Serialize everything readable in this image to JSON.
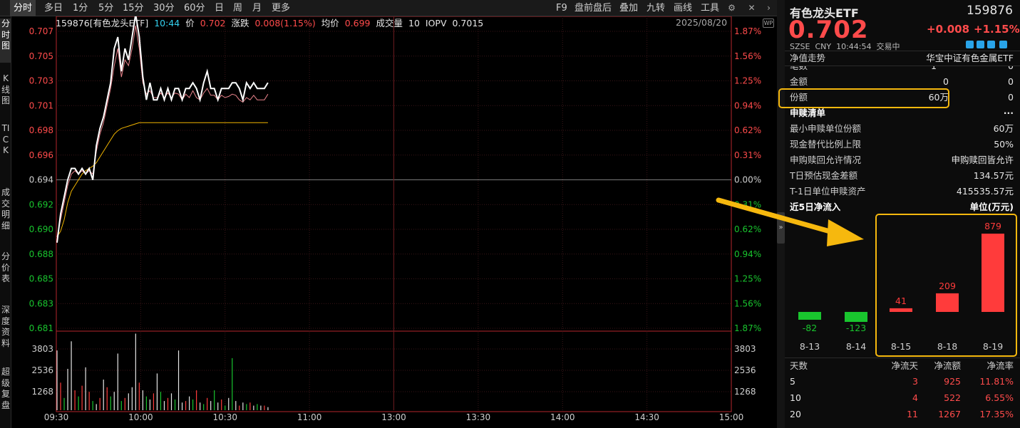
{
  "tabs": [
    "分时",
    "多日",
    "1分",
    "5分",
    "15分",
    "30分",
    "60分",
    "日",
    "周",
    "月",
    "更多"
  ],
  "toolbar": [
    "F9",
    "盘前盘后",
    "叠加",
    "九转",
    "画线",
    "工具"
  ],
  "sidebar": [
    "分时图",
    "K线图",
    "TICK",
    "成交明细",
    "分价表",
    "深度资料",
    "超级复盘"
  ],
  "info": {
    "code_name": "159876[有色龙头ETF]",
    "time": "10:44",
    "price_label": "价",
    "price": "0.702",
    "change_label": "涨跌",
    "change": "0.008(1.15%)",
    "avg_label": "均价",
    "avg": "0.699",
    "vol_label": "成交量",
    "vol": "10",
    "iopv_label": "IOPV",
    "iopv": "0.7015",
    "date": "2025/08/20"
  },
  "chart_data": {
    "type": "line",
    "y_left_ticks": [
      "0.707",
      "0.705",
      "0.703",
      "0.701",
      "0.698",
      "0.696",
      "0.694",
      "0.692",
      "0.690",
      "0.688",
      "0.685",
      "0.683",
      "0.681"
    ],
    "y_right_ticks": [
      "1.87%",
      "1.56%",
      "1.25%",
      "0.94%",
      "0.62%",
      "0.31%",
      "0.00%",
      "0.31%",
      "0.62%",
      "0.94%",
      "1.25%",
      "1.56%",
      "1.87%"
    ],
    "x_ticks": [
      "09:30",
      "10:00",
      "10:30",
      "11:00",
      "13:00",
      "13:30",
      "14:00",
      "14:30",
      "15:00"
    ],
    "vol_ticks": [
      "3803",
      "2536",
      "1268"
    ],
    "y_range": [
      0.681,
      0.707
    ],
    "prev_close": 0.694,
    "price_series": [
      0.6885,
      0.691,
      0.6925,
      0.694,
      0.695,
      0.695,
      0.6945,
      0.695,
      0.6945,
      0.695,
      0.694,
      0.697,
      0.6985,
      0.6995,
      0.701,
      0.7025,
      0.7055,
      0.7065,
      0.7035,
      0.7055,
      0.7045,
      0.7065,
      0.7085,
      0.7065,
      0.703,
      0.701,
      0.7025,
      0.701,
      0.701,
      0.702,
      0.701,
      0.702,
      0.701,
      0.702,
      0.702,
      0.701,
      0.702,
      0.702,
      0.7025,
      0.702,
      0.701,
      0.7025,
      0.7035,
      0.702,
      0.702,
      0.701,
      0.702,
      0.702,
      0.702,
      0.7025,
      0.7025,
      0.702,
      0.701,
      0.7025,
      0.702,
      0.7025,
      0.702,
      0.702,
      0.702,
      0.7025
    ],
    "avg_series": [
      0.689,
      0.6895,
      0.6905,
      0.692,
      0.693,
      0.6935,
      0.694,
      0.6945,
      0.6948,
      0.695,
      0.6952,
      0.6955,
      0.696,
      0.6965,
      0.697,
      0.6975,
      0.698,
      0.6983,
      0.6985,
      0.6986,
      0.6987,
      0.6988,
      0.6989,
      0.699,
      0.699,
      0.699,
      0.699,
      0.699,
      0.699,
      0.699,
      0.699,
      0.699,
      0.699,
      0.699,
      0.699,
      0.699,
      0.699,
      0.699,
      0.699,
      0.699,
      0.699,
      0.699,
      0.699,
      0.699,
      0.699,
      0.699,
      0.699,
      0.699,
      0.699,
      0.699,
      0.699,
      0.699,
      0.699,
      0.699,
      0.699,
      0.699,
      0.699,
      0.699,
      0.699,
      0.699
    ],
    "iopv_series": [
      0.689,
      0.6905,
      0.692,
      0.6935,
      0.6945,
      0.6948,
      0.6945,
      0.6948,
      0.6945,
      0.6948,
      0.6945,
      0.6965,
      0.698,
      0.699,
      0.7005,
      0.702,
      0.704,
      0.7055,
      0.703,
      0.7045,
      0.704,
      0.7055,
      0.7075,
      0.7055,
      0.7025,
      0.7015,
      0.7018,
      0.7012,
      0.7012,
      0.7016,
      0.7012,
      0.7016,
      0.7012,
      0.7016,
      0.7015,
      0.701,
      0.7015,
      0.7012,
      0.7018,
      0.7012,
      0.701,
      0.7016,
      0.702,
      0.7014,
      0.7014,
      0.701,
      0.7014,
      0.7012,
      0.7013,
      0.7015,
      0.7014,
      0.701,
      0.7008,
      0.7012,
      0.701,
      0.7014,
      0.701,
      0.701,
      0.701,
      0.7015
    ],
    "volume_max": 5070,
    "volume": [
      3900,
      1800,
      800,
      2700,
      4500,
      1300,
      900,
      1600,
      2800,
      1200,
      600,
      400,
      800,
      2000,
      1500,
      900,
      1200,
      3700,
      600,
      800,
      1100,
      1500,
      5000,
      1800,
      1300,
      900,
      700,
      1100,
      2400,
      1200,
      600,
      800,
      1100,
      700,
      3900,
      500,
      600,
      900,
      700,
      1300,
      500,
      400,
      800,
      600,
      1300,
      500,
      700,
      300,
      800,
      3400,
      600,
      300,
      500,
      400,
      500,
      300,
      400,
      300,
      300,
      200
    ],
    "volume_color": [
      "w",
      "r",
      "g",
      "w",
      "w",
      "r",
      "g",
      "r",
      "w",
      "r",
      "g",
      "w",
      "r",
      "w",
      "r",
      "g",
      "w",
      "w",
      "g",
      "r",
      "w",
      "w",
      "w",
      "r",
      "w",
      "g",
      "w",
      "r",
      "w",
      "g",
      "w",
      "r",
      "w",
      "g",
      "w",
      "w",
      "r",
      "w",
      "g",
      "r",
      "w",
      "g",
      "r",
      "w",
      "g",
      "w",
      "r",
      "g",
      "w",
      "g",
      "w",
      "r",
      "w",
      "g",
      "r",
      "w",
      "g",
      "w",
      "r",
      "w"
    ]
  },
  "right": {
    "name": "有色龙头ETF",
    "code": "159876",
    "price": "0.702",
    "change": "+0.008",
    "change_pct": "+1.15%",
    "exchange": "SZSE",
    "currency": "CNY",
    "time": "10:44:54",
    "status": "交易中",
    "nav_label": "净值走势",
    "index_name": "华宝中证有色金属ETF",
    "partial_row": {
      "label": "笔数",
      "v1": "1",
      "v2": "0"
    },
    "rows": [
      {
        "label": "金额",
        "v1": "0",
        "v2": "0"
      },
      {
        "label": "份额",
        "v1": "60万",
        "v2": "0"
      }
    ],
    "sub_title": "申赎清单",
    "more": "···",
    "sub_rows": [
      {
        "label": "最小申赎单位份额",
        "value": "60万"
      },
      {
        "label": "现金替代比例上限",
        "value": "50%"
      },
      {
        "label": "申购赎回允许情况",
        "value": "申购赎回皆允许"
      },
      {
        "label": "T日预估现金差额",
        "value": "134.57元"
      },
      {
        "label": "T-1日单位申赎资产",
        "value": "415535.57元"
      }
    ],
    "flow_title": "近5日净流入",
    "flow_unit": "单位(万元)",
    "flow": {
      "dates": [
        "8-13",
        "8-14",
        "8-15",
        "8-18",
        "8-19"
      ],
      "values": [
        -82,
        -123,
        41,
        209,
        879
      ]
    },
    "table_headers": [
      "天数",
      "净流天",
      "净流额",
      "净流率"
    ],
    "table_rows": [
      [
        "5",
        "3",
        "925",
        "11.81%"
      ],
      [
        "10",
        "4",
        "522",
        "6.55%"
      ],
      [
        "20",
        "11",
        "1267",
        "17.35%"
      ]
    ]
  }
}
